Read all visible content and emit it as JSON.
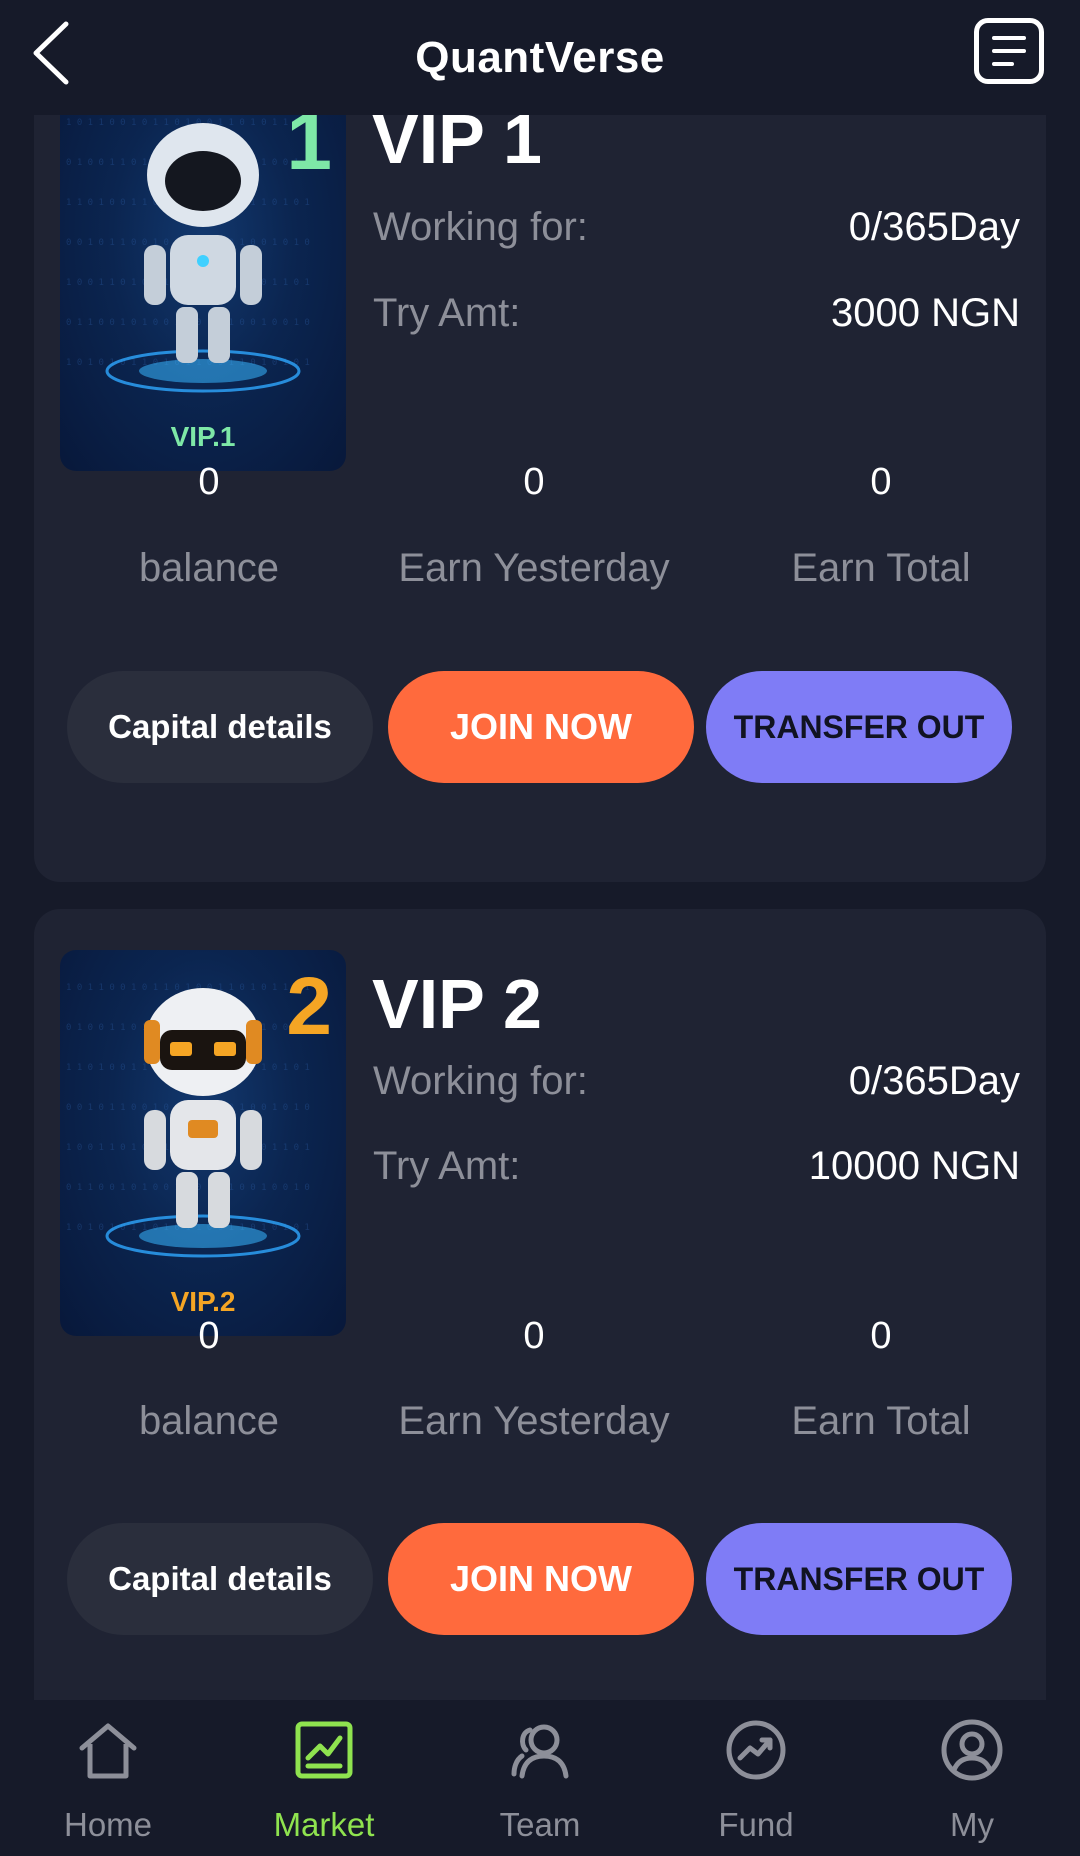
{
  "header": {
    "title": "QuantVerse",
    "back_icon": "chevron-left-icon",
    "menu_icon": "menu-list-icon"
  },
  "colors": {
    "accent_green": "#8fe34f",
    "join_orange": "#ff6a3d",
    "transfer_purple": "#7f7cf6",
    "vip1_green": "#7ee8a7",
    "vip2_orange": "#f5a524"
  },
  "cards": [
    {
      "badge_number": "1",
      "badge_text": "VIP.1",
      "name": "VIP 1",
      "working_label": "Working for:",
      "working_value": "0/365Day",
      "try_label": "Try Amt:",
      "try_value": "3000 NGN",
      "stats": [
        {
          "value": "0",
          "label": "balance"
        },
        {
          "value": "0",
          "label": "Earn Yesterday"
        },
        {
          "value": "0",
          "label": "Earn Total"
        }
      ],
      "buttons": {
        "capital": "Capital details",
        "join": "JOIN NOW",
        "transfer": "TRANSFER OUT"
      }
    },
    {
      "badge_number": "2",
      "badge_text": "VIP.2",
      "name": "VIP 2",
      "working_label": "Working for:",
      "working_value": "0/365Day",
      "try_label": "Try Amt:",
      "try_value": "10000 NGN",
      "stats": [
        {
          "value": "0",
          "label": "balance"
        },
        {
          "value": "0",
          "label": "Earn Yesterday"
        },
        {
          "value": "0",
          "label": "Earn Total"
        }
      ],
      "buttons": {
        "capital": "Capital details",
        "join": "JOIN NOW",
        "transfer": "TRANSFER OUT"
      }
    }
  ],
  "nav": [
    {
      "label": "Home",
      "icon": "home-icon",
      "active": false
    },
    {
      "label": "Market",
      "icon": "market-chart-icon",
      "active": true
    },
    {
      "label": "Team",
      "icon": "team-icon",
      "active": false
    },
    {
      "label": "Fund",
      "icon": "fund-trend-icon",
      "active": false
    },
    {
      "label": "My",
      "icon": "user-icon",
      "active": false
    }
  ]
}
